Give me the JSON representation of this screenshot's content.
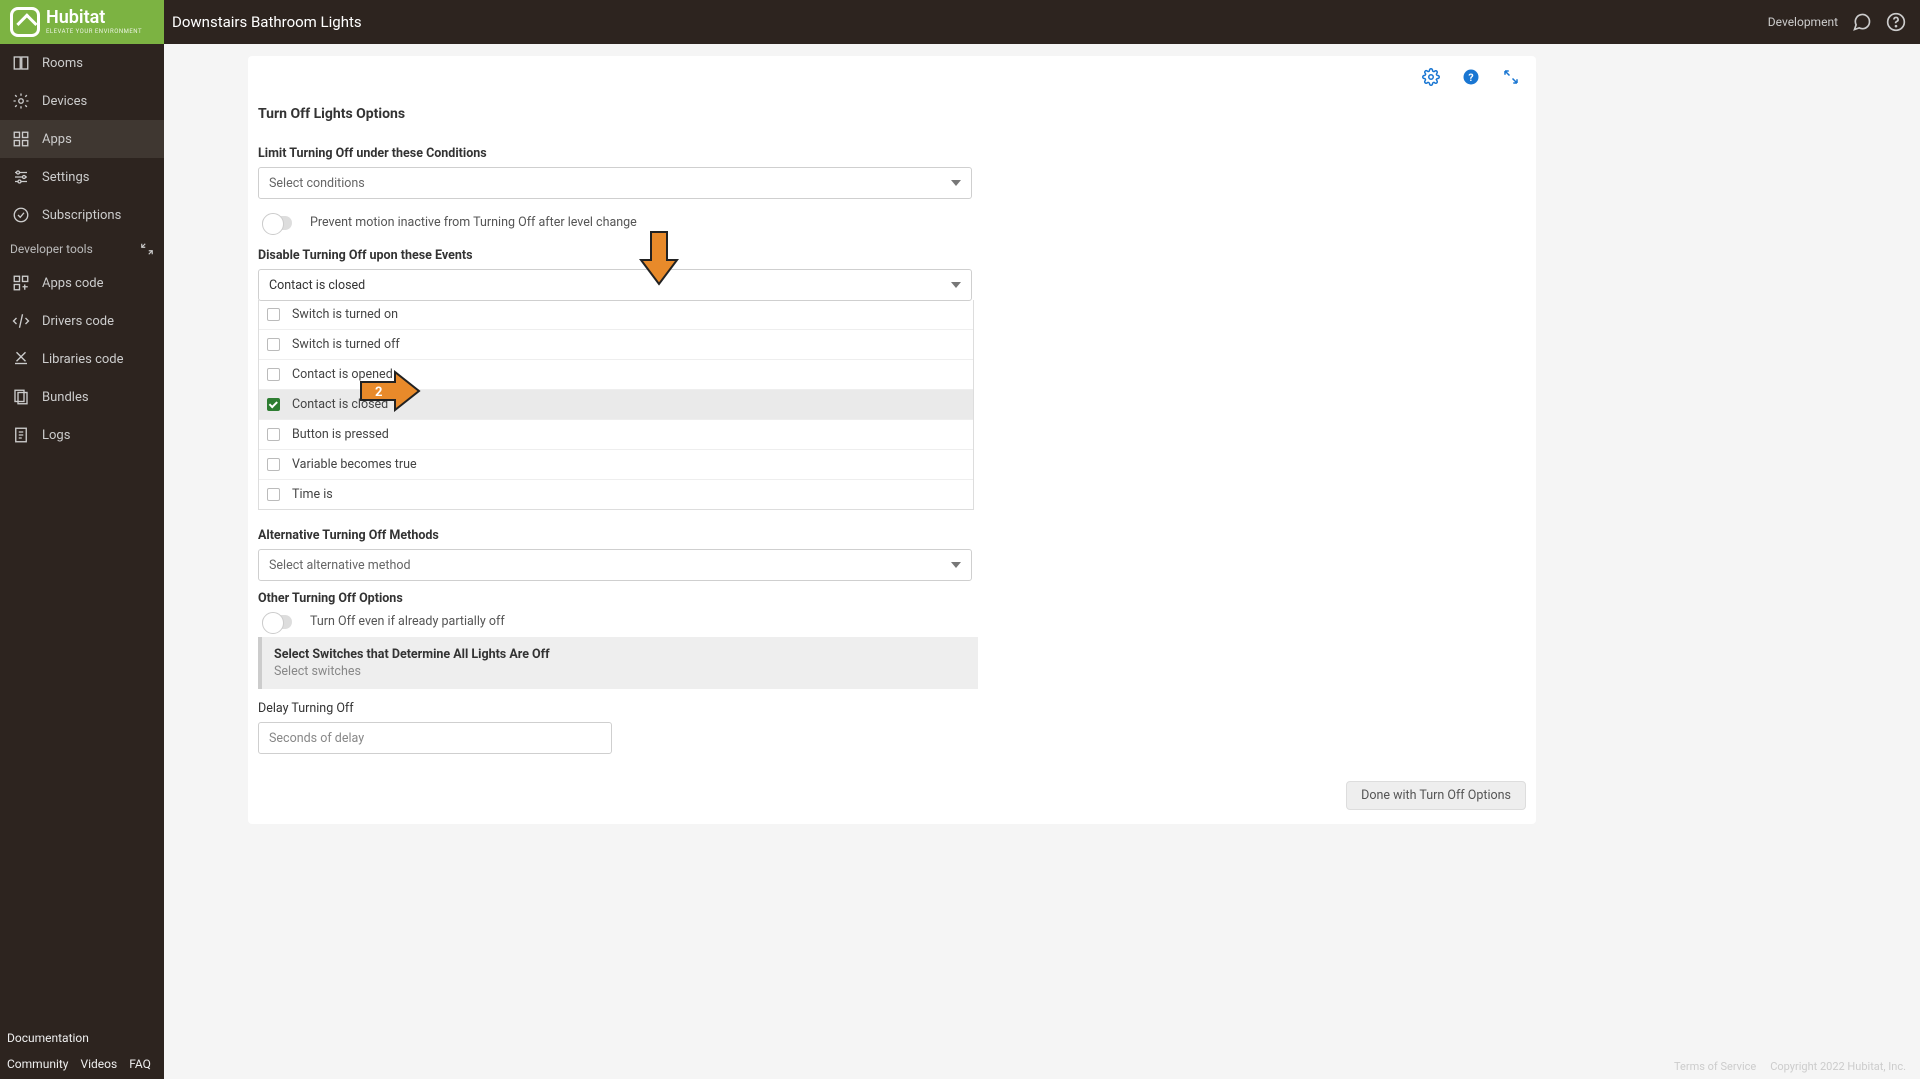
{
  "header": {
    "brand_name": "Hubitat",
    "brand_tag": "ELEVATE YOUR ENVIRONMENT",
    "page_title": "Downstairs Bathroom Lights",
    "mode": "Development"
  },
  "sidebar": {
    "items": [
      {
        "label": "Rooms",
        "icon": "rooms-icon"
      },
      {
        "label": "Devices",
        "icon": "devices-icon"
      },
      {
        "label": "Apps",
        "icon": "apps-icon",
        "active": true
      },
      {
        "label": "Settings",
        "icon": "settings-icon"
      },
      {
        "label": "Subscriptions",
        "icon": "subscriptions-icon"
      }
    ],
    "dev_tools_label": "Developer tools",
    "dev_items": [
      {
        "label": "Apps code",
        "icon": "appscode-icon"
      },
      {
        "label": "Drivers code",
        "icon": "driverscode-icon"
      },
      {
        "label": "Libraries code",
        "icon": "librariescode-icon"
      },
      {
        "label": "Bundles",
        "icon": "bundles-icon"
      },
      {
        "label": "Logs",
        "icon": "logs-icon"
      }
    ],
    "footer_links": [
      "Documentation",
      "Community",
      "Videos",
      "FAQ"
    ]
  },
  "content": {
    "section_title": "Turn Off Lights Options",
    "limit_label": "Limit Turning Off under these Conditions",
    "limit_placeholder": "Select conditions",
    "prevent_toggle_label": "Prevent motion inactive from Turning Off after level change",
    "disable_label": "Disable Turning Off upon these Events",
    "disable_selected": "Contact is closed",
    "disable_options": [
      {
        "label": "Switch is turned on",
        "checked": false
      },
      {
        "label": "Switch is turned off",
        "checked": false
      },
      {
        "label": "Contact is opened",
        "checked": false
      },
      {
        "label": "Contact is closed",
        "checked": true
      },
      {
        "label": "Button is pressed",
        "checked": false
      },
      {
        "label": "Variable becomes true",
        "checked": false
      },
      {
        "label": "Time is",
        "checked": false
      }
    ],
    "alt_label": "Alternative Turning Off Methods",
    "alt_placeholder": "Select alternative method",
    "other_label": "Other Turning Off Options",
    "turnoff_partial_label": "Turn Off even if already partially off",
    "switches_title": "Select Switches that Determine All Lights Are Off",
    "switches_placeholder": "Select switches",
    "delay_label": "Delay Turning Off",
    "delay_placeholder": "Seconds of delay",
    "done_label": "Done with Turn Off Options"
  },
  "footer_right": {
    "tos": "Terms of Service",
    "copyright": "Copyright 2022 Hubitat, Inc."
  },
  "annotation": {
    "arrow2_label": "2"
  }
}
